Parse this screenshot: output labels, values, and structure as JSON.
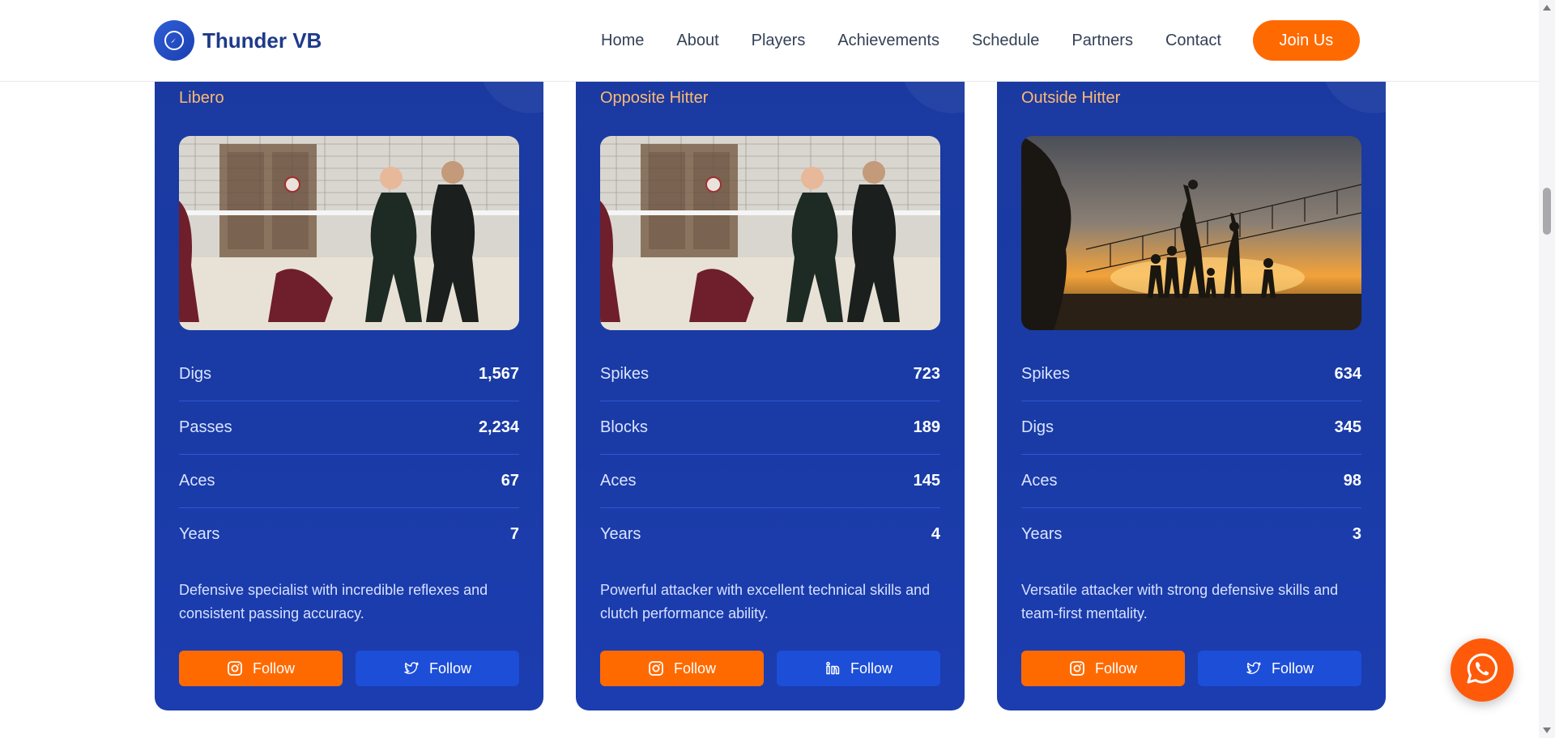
{
  "brand": {
    "name": "Thunder VB",
    "logo_icon": "compass-icon"
  },
  "nav": {
    "items": [
      "Home",
      "About",
      "Players",
      "Achievements",
      "Schedule",
      "Partners",
      "Contact"
    ],
    "cta": "Join Us"
  },
  "colors": {
    "accent": "#ff6a00",
    "card": "#1b3aa0",
    "position": "#fdba74",
    "secondary_button": "#1d4ed8"
  },
  "players": [
    {
      "position": "Libero",
      "photo": "indoor-volleyball-action-photo",
      "stats": [
        {
          "label": "Digs",
          "value": "1,567"
        },
        {
          "label": "Passes",
          "value": "2,234"
        },
        {
          "label": "Aces",
          "value": "67"
        },
        {
          "label": "Years",
          "value": "7"
        }
      ],
      "bio": "Defensive specialist with incredible reflexes and consistent passing accuracy.",
      "buttons": [
        {
          "label": "Follow",
          "icon": "instagram-icon"
        },
        {
          "label": "Follow",
          "icon": "twitter-icon"
        }
      ]
    },
    {
      "position": "Opposite Hitter",
      "photo": "indoor-volleyball-action-photo",
      "stats": [
        {
          "label": "Spikes",
          "value": "723"
        },
        {
          "label": "Blocks",
          "value": "189"
        },
        {
          "label": "Aces",
          "value": "145"
        },
        {
          "label": "Years",
          "value": "4"
        }
      ],
      "bio": "Powerful attacker with excellent technical skills and clutch performance ability.",
      "buttons": [
        {
          "label": "Follow",
          "icon": "instagram-icon"
        },
        {
          "label": "Follow",
          "icon": "linkedin-icon"
        }
      ]
    },
    {
      "position": "Outside Hitter",
      "photo": "beach-volleyball-sunset-photo",
      "stats": [
        {
          "label": "Spikes",
          "value": "634"
        },
        {
          "label": "Digs",
          "value": "345"
        },
        {
          "label": "Aces",
          "value": "98"
        },
        {
          "label": "Years",
          "value": "3"
        }
      ],
      "bio": "Versatile attacker with strong defensive skills and team-first mentality.",
      "buttons": [
        {
          "label": "Follow",
          "icon": "instagram-icon"
        },
        {
          "label": "Follow",
          "icon": "twitter-icon"
        }
      ]
    }
  ],
  "whatsapp": {
    "icon": "whatsapp-icon"
  }
}
